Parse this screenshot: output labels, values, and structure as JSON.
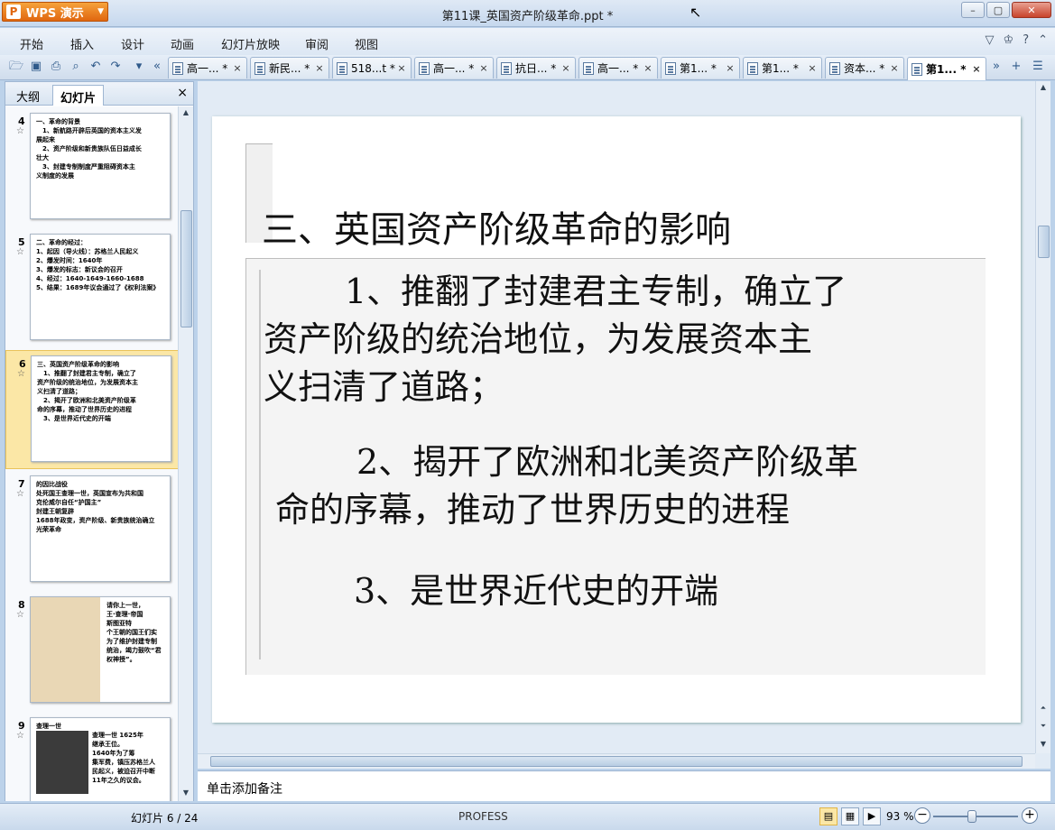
{
  "app": {
    "name": "WPS 演示",
    "window_title": "第11课_英国资产阶级革命.ppt *"
  },
  "menu": [
    "开始",
    "插入",
    "设计",
    "动画",
    "幻灯片放映",
    "审阅",
    "视图"
  ],
  "doc_tabs": [
    {
      "label": "高一... *",
      "close": "×"
    },
    {
      "label": "新民... *",
      "close": "×"
    },
    {
      "label": "518...t *",
      "close": "×"
    },
    {
      "label": "高一... *",
      "close": "×"
    },
    {
      "label": "抗日... *",
      "close": "×"
    },
    {
      "label": "高一... *",
      "close": "×"
    },
    {
      "label": "第1... *",
      "close": "×"
    },
    {
      "label": "第1... *",
      "close": "×"
    },
    {
      "label": "资本... *",
      "close": "×"
    },
    {
      "label": "第1... *",
      "close": "×"
    }
  ],
  "left_panel": {
    "tabs": [
      "大纲",
      "幻灯片"
    ],
    "close": "×",
    "slides": [
      {
        "num": "4",
        "lines": [
          "一、革命的背景",
          "　1、新航路开辟后英国的资本主义发",
          "展起来",
          "　2、资产阶级和新贵族队伍日益成长",
          "壮大",
          "　3、封建专制制度严重阻碍资本主",
          "义制度的发展"
        ]
      },
      {
        "num": "5",
        "lines": [
          "二、革命的经过：",
          "1、起因（导火线）：苏格兰人民起义",
          "2、爆发时间：1640年",
          "3、爆发的标志：新议会的召开",
          "4、经过：1640-1649-1660-1688",
          "5、结果：1689年议会通过了《权利法案》"
        ]
      },
      {
        "num": "6",
        "lines": [
          "三、英国资产阶级革命的影响",
          "　1、推翻了封建君主专制，确立了",
          "资产阶级的统治地位，为发展资本主",
          "义扫清了道路；",
          "　2、揭开了欧洲和北美资产阶级革",
          "命的序幕，推动了世界历史的进程",
          "　3、是世界近代史的开端"
        ]
      },
      {
        "num": "7",
        "lines": [
          "的因比战役",
          "处死国王查理一世，英国宣布为共和国",
          "克伦威尔自任“护国主”",
          "封建王朝复辟",
          "1688年政变，资产阶级、新贵族统治确立",
          "光荣革命"
        ]
      },
      {
        "num": "8",
        "lines": [
          "请你上一世，",
          "王·查理·帝国",
          "斯图亚特",
          "个王朝的国王们实",
          "为了维护封建专制",
          "统治，竭力鼓吹“君",
          "权神授”。"
        ]
      },
      {
        "num": "9",
        "lines": [
          "查理一世",
          "查理一世 1625年",
          "继承王位。",
          "1640年为了筹",
          "集军费，镇压苏格兰人",
          "民起义，被迫召开中断",
          "11年之久的议会。"
        ]
      }
    ]
  },
  "slide": {
    "title": "三、英国资产阶级革命的影响",
    "point1_line1": "1、推翻了封建君主专制，确立了",
    "point1_line2": "资产阶级的统治地位，为发展资本主",
    "point1_line3": "义扫清了道路；",
    "point2_line1": "2、揭开了欧洲和北美资产阶级革",
    "point2_line2": "命的序幕，推动了世界历史的进程",
    "point3": "3、是世界近代史的开端"
  },
  "notes_placeholder": "单击添加备注",
  "status": {
    "slide_counter": "幻灯片 6 / 24",
    "theme": "PROFESS",
    "zoom": "93 %",
    "zoom_level_percent": 93
  },
  "icons": [
    "open-folder-icon",
    "save-icon",
    "print-icon",
    "print-preview-icon",
    "undo-icon",
    "redo-icon"
  ],
  "colors": {
    "app_button": "#e0660f",
    "selected_thumb": "#fbe7a6",
    "chrome": "#c6d8ee"
  }
}
